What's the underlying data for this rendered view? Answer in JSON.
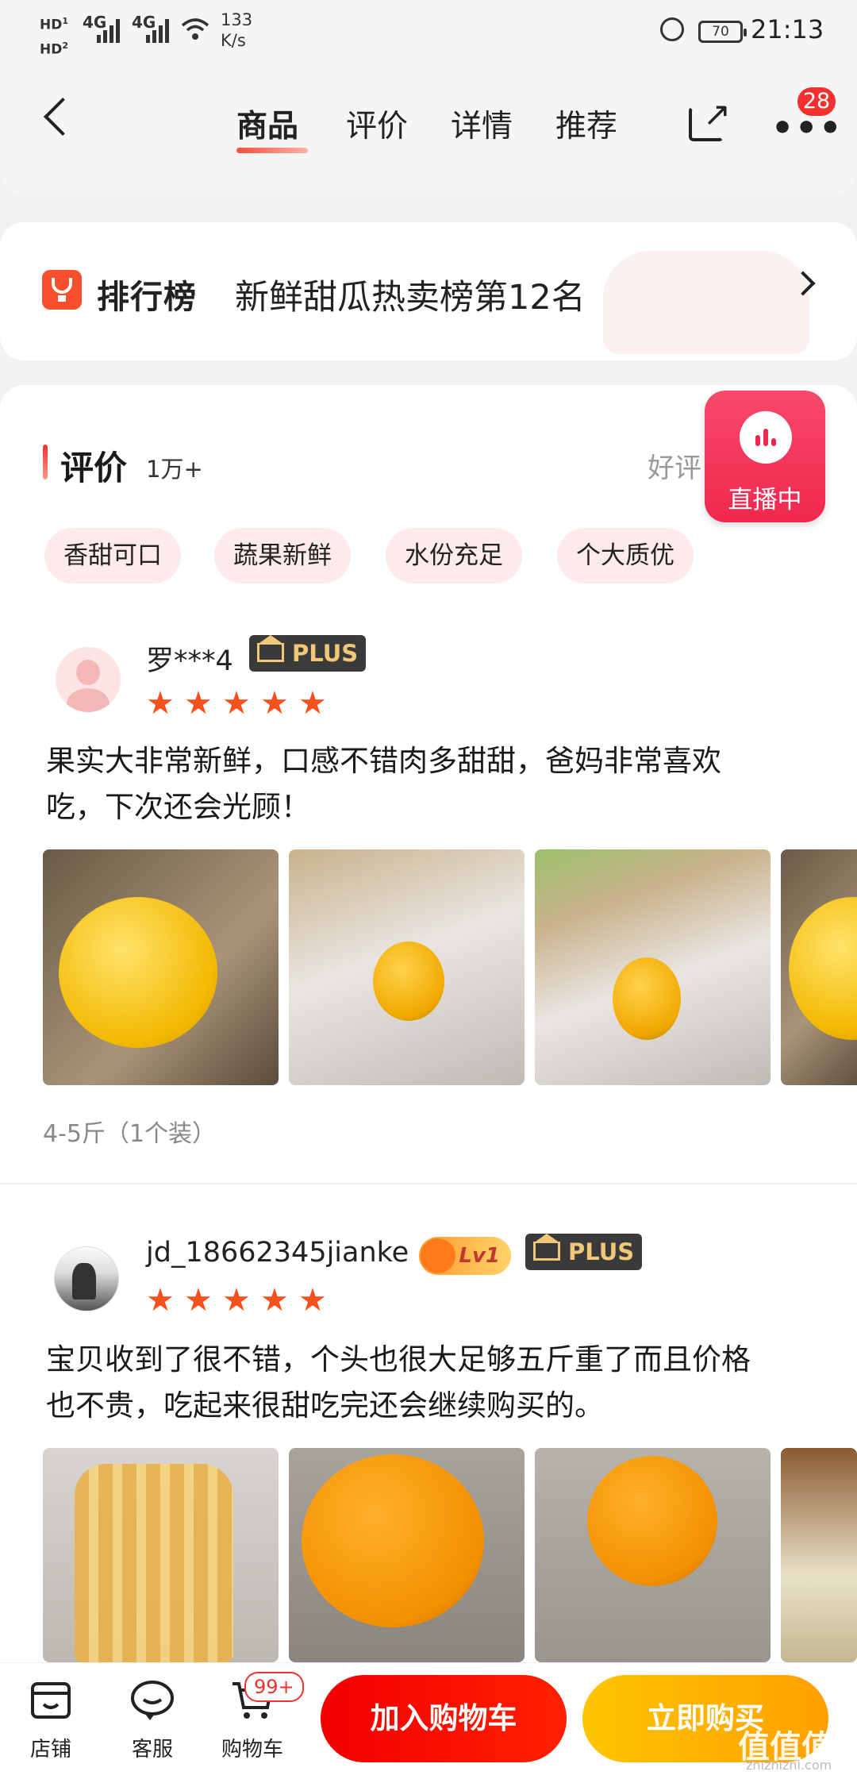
{
  "status_bar": {
    "hd1": "HD",
    "hd2": "HD",
    "sim1": "1",
    "sim2": "2",
    "net1": "4G",
    "net2": "4G",
    "speed_value": "133",
    "speed_unit": "K/s",
    "battery": "70",
    "time": "21:13"
  },
  "header": {
    "tabs": [
      "商品",
      "评价",
      "详情",
      "推荐"
    ],
    "active_tab": "商品",
    "message_count": "28"
  },
  "ranking": {
    "brand": "排行榜",
    "text": "新鲜甜瓜热卖榜第12名"
  },
  "reviews_section": {
    "title": "评价",
    "count": "1万+",
    "good_rate_label": "好评",
    "live_label": "直播中",
    "tags": [
      "香甜可口",
      "蔬果新鲜",
      "水份充足",
      "个大质优"
    ]
  },
  "reviews": [
    {
      "user": "罗***4",
      "member_badge": "PLUS",
      "rating": 5,
      "text_line1": "果实大非常新鲜，口感不错肉多甜甜，爸妈非常喜欢",
      "text_line2": "吃，下次还会光顾！",
      "spec": "4-5斤（1个装）"
    },
    {
      "user": "jd_18662345jianke",
      "level_badge": "Lv1",
      "member_badge": "PLUS",
      "rating": 5,
      "text_line1": "宝贝收到了很不错，个头也很大足够五斤重了而且价格",
      "text_line2": "也不贵，吃起来很甜吃完还会继续购买的。"
    }
  ],
  "bottom_bar": {
    "shop": "店铺",
    "service": "客服",
    "cart": "购物车",
    "cart_count": "99+",
    "add_to_cart": "加入购物车",
    "buy_now": "立即购买"
  },
  "watermark": {
    "logo": "值值值",
    "site": "zhizhizhi.com"
  },
  "colors": {
    "accent_red": "#f23030",
    "star_orange": "#f5511e",
    "buy_yellow": "#ffb000",
    "chip_bg": "#fdeaea"
  }
}
